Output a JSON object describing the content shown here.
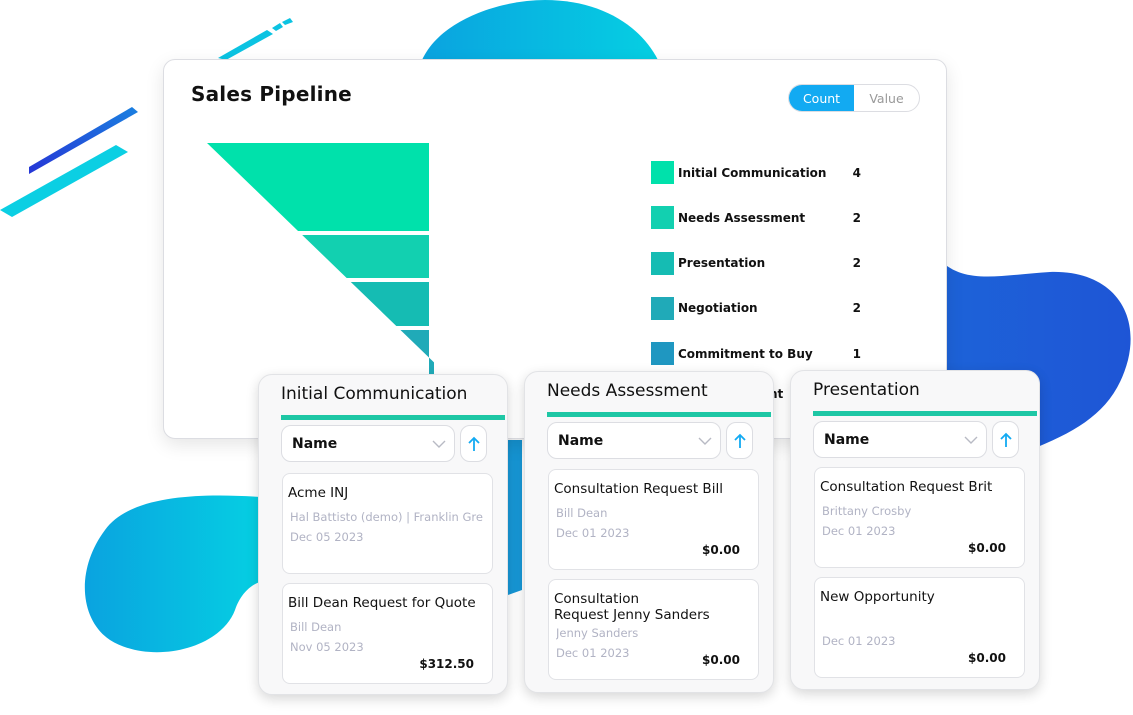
{
  "colors": {
    "accent_blue": "#12aaf2",
    "stage_bar": "#1ec7a5",
    "stage_colors": [
      "#00e1ab",
      "#12d0b0",
      "#15bcb3",
      "#20aab8",
      "#1f97c1"
    ]
  },
  "pipeline": {
    "title": "Sales Pipeline",
    "toggle": {
      "options": [
        "Count",
        "Value"
      ],
      "selected": "Count"
    },
    "stages": [
      {
        "label": "Initial Communication",
        "count": "4"
      },
      {
        "label": "Needs Assessment",
        "count": "2"
      },
      {
        "label": "Presentation",
        "count": "2"
      },
      {
        "label": "Negotiation",
        "count": "2"
      },
      {
        "label": "Commitment to Buy",
        "count": "1"
      }
    ],
    "obscured_partial_label": "nt"
  },
  "columns": [
    {
      "title": "Initial Communication",
      "sort_field": "Name",
      "cards": [
        {
          "title": "Acme INJ",
          "contact": "Hal Battisto (demo) | Franklin Gre",
          "date": "Dec 05 2023",
          "amount": ""
        },
        {
          "title": "Bill Dean Request for Quote",
          "contact": "Bill Dean",
          "date": "Nov 05 2023",
          "amount": "$312.50"
        }
      ]
    },
    {
      "title": "Needs Assessment",
      "sort_field": "Name",
      "cards": [
        {
          "title": "Consultation Request Bill",
          "contact": "Bill Dean",
          "date": "Dec 01 2023",
          "amount": "$0.00"
        },
        {
          "title": "Consultation",
          "title_line2": "Request Jenny Sanders",
          "contact": "Jenny Sanders",
          "date": "Dec 01 2023",
          "amount": "$0.00"
        }
      ]
    },
    {
      "title": "Presentation",
      "sort_field": "Name",
      "cards": [
        {
          "title": "Consultation Request Brit",
          "contact": "Brittany Crosby",
          "date": "Dec 01 2023",
          "amount": "$0.00"
        },
        {
          "title": "New Opportunity",
          "contact": "",
          "date": "Dec 01 2023",
          "amount": "$0.00"
        }
      ]
    }
  ],
  "icons": {
    "sort_dropdown": "chevron-down-icon",
    "sort_direction": "arrow-up-icon"
  }
}
